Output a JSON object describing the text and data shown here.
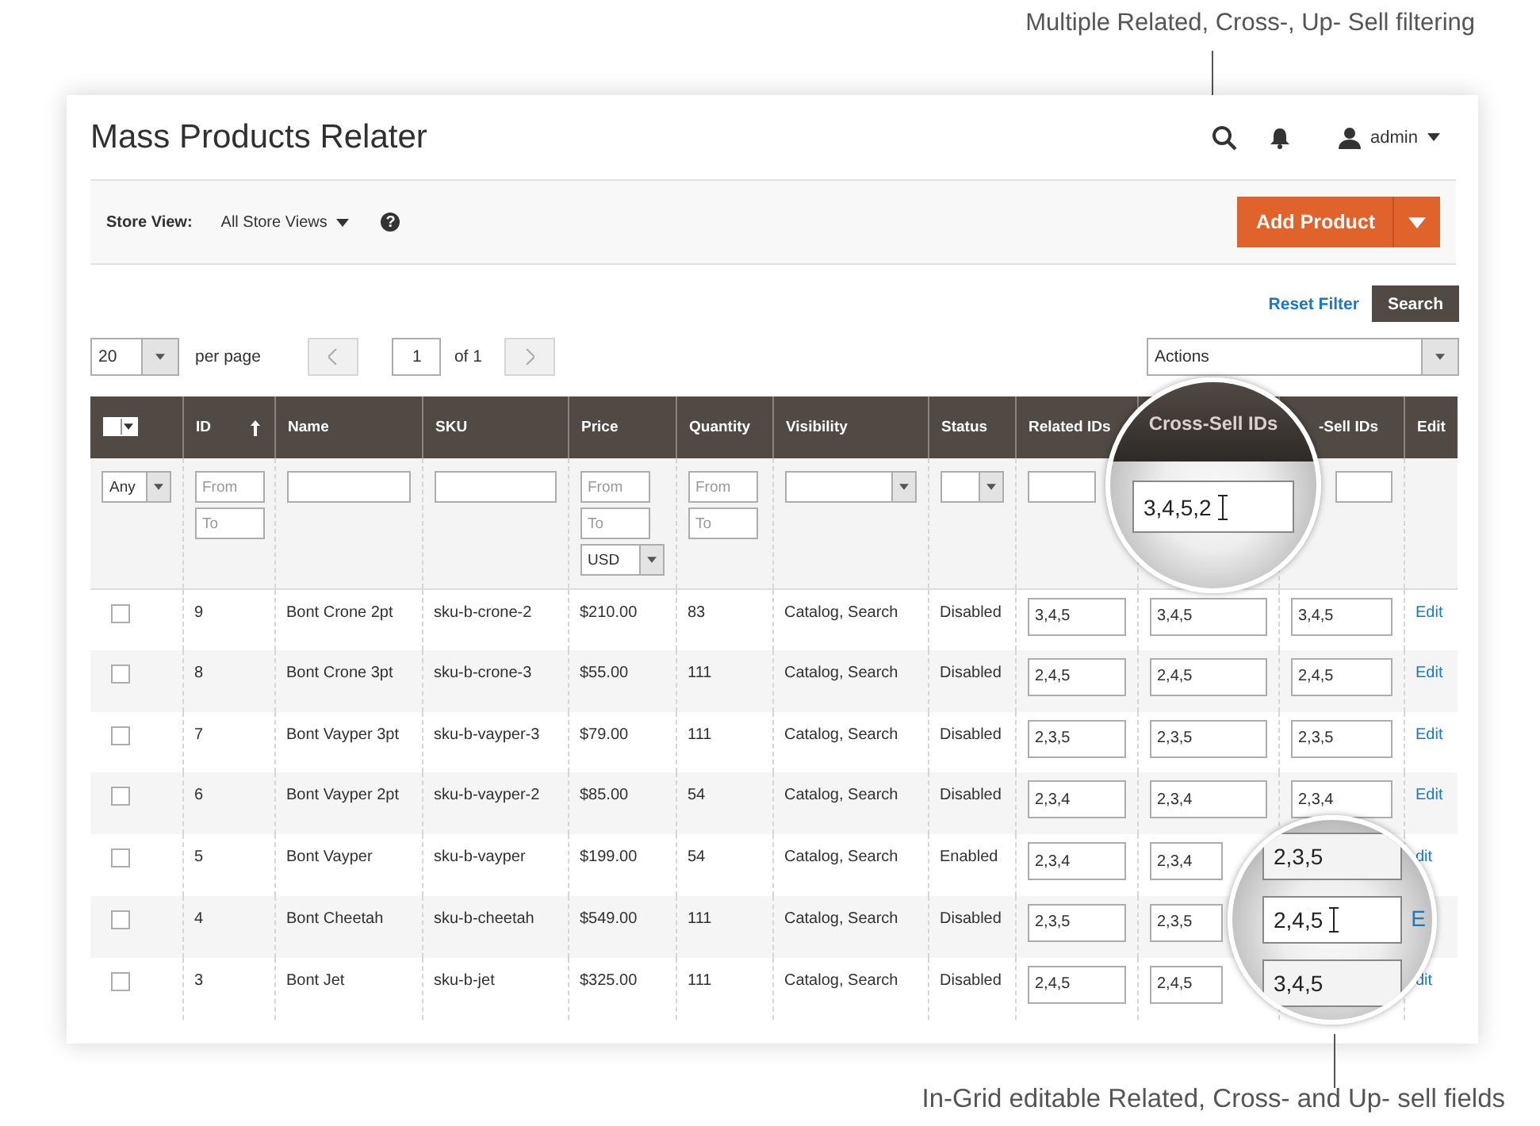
{
  "annotations": {
    "top": "Multiple Related, Cross-, Up- Sell filtering",
    "bottom": "In-Grid editable Related, Cross- and Up- sell fields"
  },
  "header": {
    "title": "Mass Products Relater",
    "user": "admin"
  },
  "toolbar": {
    "store_view_label": "Store View:",
    "store_view_value": "All Store Views",
    "help": "?",
    "add_button": "Add Product"
  },
  "grid": {
    "reset_filter": "Reset Filter",
    "search_button": "Search",
    "per_page_value": "20",
    "per_page_label": "per page",
    "page": "1",
    "page_total": "of 1",
    "actions": "Actions"
  },
  "columns": [
    {
      "kind": "mass-select",
      "checked": false
    },
    {
      "kind": "label",
      "label": "ID",
      "sorted": true
    },
    {
      "kind": "label",
      "label": "Name",
      "sorted": false
    },
    {
      "kind": "label",
      "label": "SKU",
      "sorted": false
    },
    {
      "kind": "label",
      "label": "Price",
      "sorted": false
    },
    {
      "kind": "label",
      "label": "Quantity",
      "sorted": false
    },
    {
      "kind": "label",
      "label": "Visibility",
      "sorted": false
    },
    {
      "kind": "label",
      "label": "Status",
      "sorted": false
    },
    {
      "kind": "label",
      "label": "Related IDs",
      "sorted": false
    },
    {
      "kind": "covered"
    },
    {
      "kind": "label",
      "label": "-Sell IDs",
      "sorted": false
    },
    {
      "kind": "label",
      "label": "Edit",
      "sorted": false
    }
  ],
  "filters": [
    {
      "kind": "select",
      "value": "Any"
    },
    {
      "kind": "range",
      "from": "From",
      "to": "To"
    },
    {
      "kind": "text"
    },
    {
      "kind": "text"
    },
    {
      "kind": "range",
      "from": "From",
      "to": "To",
      "currency": "USD"
    },
    {
      "kind": "range",
      "from": "From",
      "to": "To"
    },
    {
      "kind": "select"
    },
    {
      "kind": "select"
    },
    {
      "kind": "text"
    },
    {
      "kind": "none"
    },
    {
      "kind": "text"
    },
    {
      "kind": "none"
    }
  ],
  "rows": [
    {
      "checked": false,
      "id": "9",
      "name": "Bont Crone 2pt",
      "sku": "sku-b-crone-2",
      "price": "$210.00",
      "quantity": "83",
      "visibility": "Catalog, Search",
      "status": "Disabled",
      "related": "3,4,5",
      "cross_sell": "3,4,5",
      "up_sell": "3,4,5",
      "edit": "Edit"
    },
    {
      "checked": false,
      "id": "8",
      "name": "Bont Crone 3pt",
      "sku": "sku-b-crone-3",
      "price": "$55.00",
      "quantity": "111",
      "visibility": "Catalog, Search",
      "status": "Disabled",
      "related": "2,4,5",
      "cross_sell": "2,4,5",
      "up_sell": "2,4,5",
      "edit": "Edit"
    },
    {
      "checked": false,
      "id": "7",
      "name": "Bont Vayper 3pt",
      "sku": "sku-b-vayper-3",
      "price": "$79.00",
      "quantity": "111",
      "visibility": "Catalog, Search",
      "status": "Disabled",
      "related": "2,3,5",
      "cross_sell": "2,3,5",
      "up_sell": "2,3,5",
      "edit": "Edit"
    },
    {
      "checked": false,
      "id": "6",
      "name": "Bont Vayper 2pt",
      "sku": "sku-b-vayper-2",
      "price": "$85.00",
      "quantity": "54",
      "visibility": "Catalog, Search",
      "status": "Disabled",
      "related": "2,3,4",
      "cross_sell": "2,3,4",
      "up_sell": "2,3,4",
      "edit": "Edit"
    },
    {
      "checked": false,
      "id": "5",
      "name": "Bont Vayper",
      "sku": "sku-b-vayper",
      "price": "$199.00",
      "quantity": "54",
      "visibility": "Catalog, Search",
      "status": "Enabled",
      "related": "2,3,4",
      "cross_sell": "2,3,4",
      "edit": "dit"
    },
    {
      "checked": false,
      "id": "4",
      "name": "Bont Cheetah",
      "sku": "sku-b-cheetah",
      "price": "$549.00",
      "quantity": "111",
      "visibility": "Catalog, Search",
      "status": "Disabled",
      "related": "2,3,5",
      "cross_sell": "2,3,5"
    },
    {
      "checked": false,
      "id": "3",
      "name": "Bont Jet",
      "sku": "sku-b-jet",
      "price": "$325.00",
      "quantity": "111",
      "visibility": "Catalog, Search",
      "status": "Disabled",
      "related": "2,4,5",
      "cross_sell": "2,4,5",
      "edit": "dit"
    }
  ],
  "magnifiers": [
    {
      "kind": "header-filter",
      "header": "Cross-Sell IDs",
      "value": "3,4,5,2"
    },
    {
      "kind": "grid-fields",
      "values": [
        "2,3,5",
        "2,4,5",
        "3,4,5"
      ],
      "edit_fragment": "E"
    }
  ]
}
